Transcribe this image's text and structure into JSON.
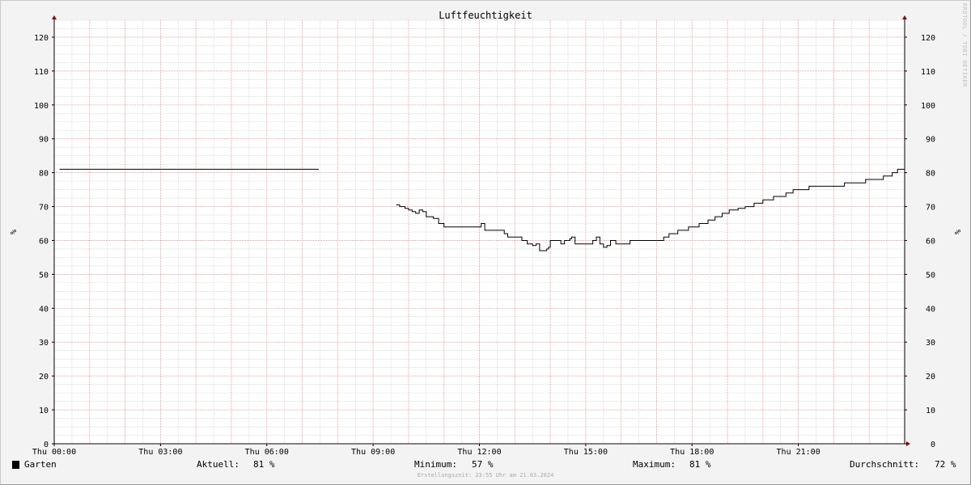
{
  "watermark": "RRDTOOL / TOBI OETIKER",
  "chart_data": {
    "type": "line",
    "title": "Luftfeuchtigkeit",
    "ylabel": "%",
    "ylabel_right": "%",
    "xlabel": "",
    "ylim": [
      0,
      125
    ],
    "xlim_hours": [
      0,
      24
    ],
    "y_ticks": [
      0,
      10,
      20,
      30,
      40,
      50,
      60,
      70,
      80,
      90,
      100,
      110,
      120
    ],
    "x_ticks": [
      {
        "h": 0,
        "label": "Thu 00:00"
      },
      {
        "h": 3,
        "label": "Thu 03:00"
      },
      {
        "h": 6,
        "label": "Thu 06:00"
      },
      {
        "h": 9,
        "label": "Thu 09:00"
      },
      {
        "h": 12,
        "label": "Thu 12:00"
      },
      {
        "h": 15,
        "label": "Thu 15:00"
      },
      {
        "h": 18,
        "label": "Thu 18:00"
      },
      {
        "h": 21,
        "label": "Thu 21:00"
      }
    ],
    "grid": true,
    "colors": {
      "line": "#000000",
      "major_grid": "#f08080",
      "minor_grid": "#c8c8c8",
      "axis": "#000000",
      "arrow": "#8b0000",
      "background": "#ffffff"
    },
    "series": [
      {
        "name": "Garten",
        "segments": [
          [
            [
              0.15,
              81
            ],
            [
              7.4,
              81
            ],
            [
              7.45,
              80.8
            ]
          ],
          [
            [
              9.65,
              70.5
            ],
            [
              9.75,
              70
            ],
            [
              9.9,
              69.5
            ],
            [
              10.0,
              69
            ],
            [
              10.1,
              68.5
            ],
            [
              10.2,
              68
            ],
            [
              10.3,
              69
            ],
            [
              10.4,
              68.5
            ],
            [
              10.5,
              67
            ],
            [
              10.7,
              66.5
            ],
            [
              10.85,
              65
            ],
            [
              11.0,
              64
            ],
            [
              12.0,
              64
            ],
            [
              12.05,
              65
            ],
            [
              12.15,
              63
            ],
            [
              12.6,
              63
            ],
            [
              12.7,
              62
            ],
            [
              12.8,
              61
            ],
            [
              13.1,
              61
            ],
            [
              13.2,
              60
            ],
            [
              13.35,
              59
            ],
            [
              13.5,
              58.5
            ],
            [
              13.6,
              59
            ],
            [
              13.7,
              57
            ],
            [
              13.9,
              57.5
            ],
            [
              13.95,
              58
            ],
            [
              14.0,
              60
            ],
            [
              14.2,
              60
            ],
            [
              14.3,
              59
            ],
            [
              14.4,
              60
            ],
            [
              14.55,
              60.5
            ],
            [
              14.6,
              61
            ],
            [
              14.7,
              59
            ],
            [
              15.1,
              59
            ],
            [
              15.2,
              60
            ],
            [
              15.3,
              61
            ],
            [
              15.4,
              59
            ],
            [
              15.5,
              58
            ],
            [
              15.6,
              58.5
            ],
            [
              15.7,
              60
            ],
            [
              15.85,
              59
            ],
            [
              16.2,
              59
            ],
            [
              16.25,
              60
            ],
            [
              17.1,
              60
            ],
            [
              17.2,
              61
            ],
            [
              17.35,
              62
            ],
            [
              17.6,
              63
            ],
            [
              17.9,
              64
            ],
            [
              18.2,
              65
            ],
            [
              18.45,
              66
            ],
            [
              18.65,
              67
            ],
            [
              18.85,
              68
            ],
            [
              19.05,
              69
            ],
            [
              19.3,
              69.5
            ],
            [
              19.5,
              70
            ],
            [
              19.75,
              71
            ],
            [
              20.0,
              72
            ],
            [
              20.3,
              73
            ],
            [
              20.65,
              74
            ],
            [
              20.85,
              75
            ],
            [
              21.3,
              76
            ],
            [
              22.3,
              77
            ],
            [
              22.9,
              78
            ],
            [
              23.4,
              79
            ],
            [
              23.65,
              80
            ],
            [
              23.8,
              81
            ],
            [
              24.0,
              81
            ]
          ]
        ]
      }
    ]
  },
  "legend": {
    "series_name": "Garten",
    "current_label": "Aktuell:",
    "current_value": "81 %",
    "min_label": "Minimum:",
    "min_value": "57 %",
    "max_label": "Maximum:",
    "max_value": "81 %",
    "avg_label": "Durchschnitt:",
    "avg_value": "72 %"
  },
  "footer": "Erstellungszeit: 23:55 Uhr am 21.03.2024"
}
